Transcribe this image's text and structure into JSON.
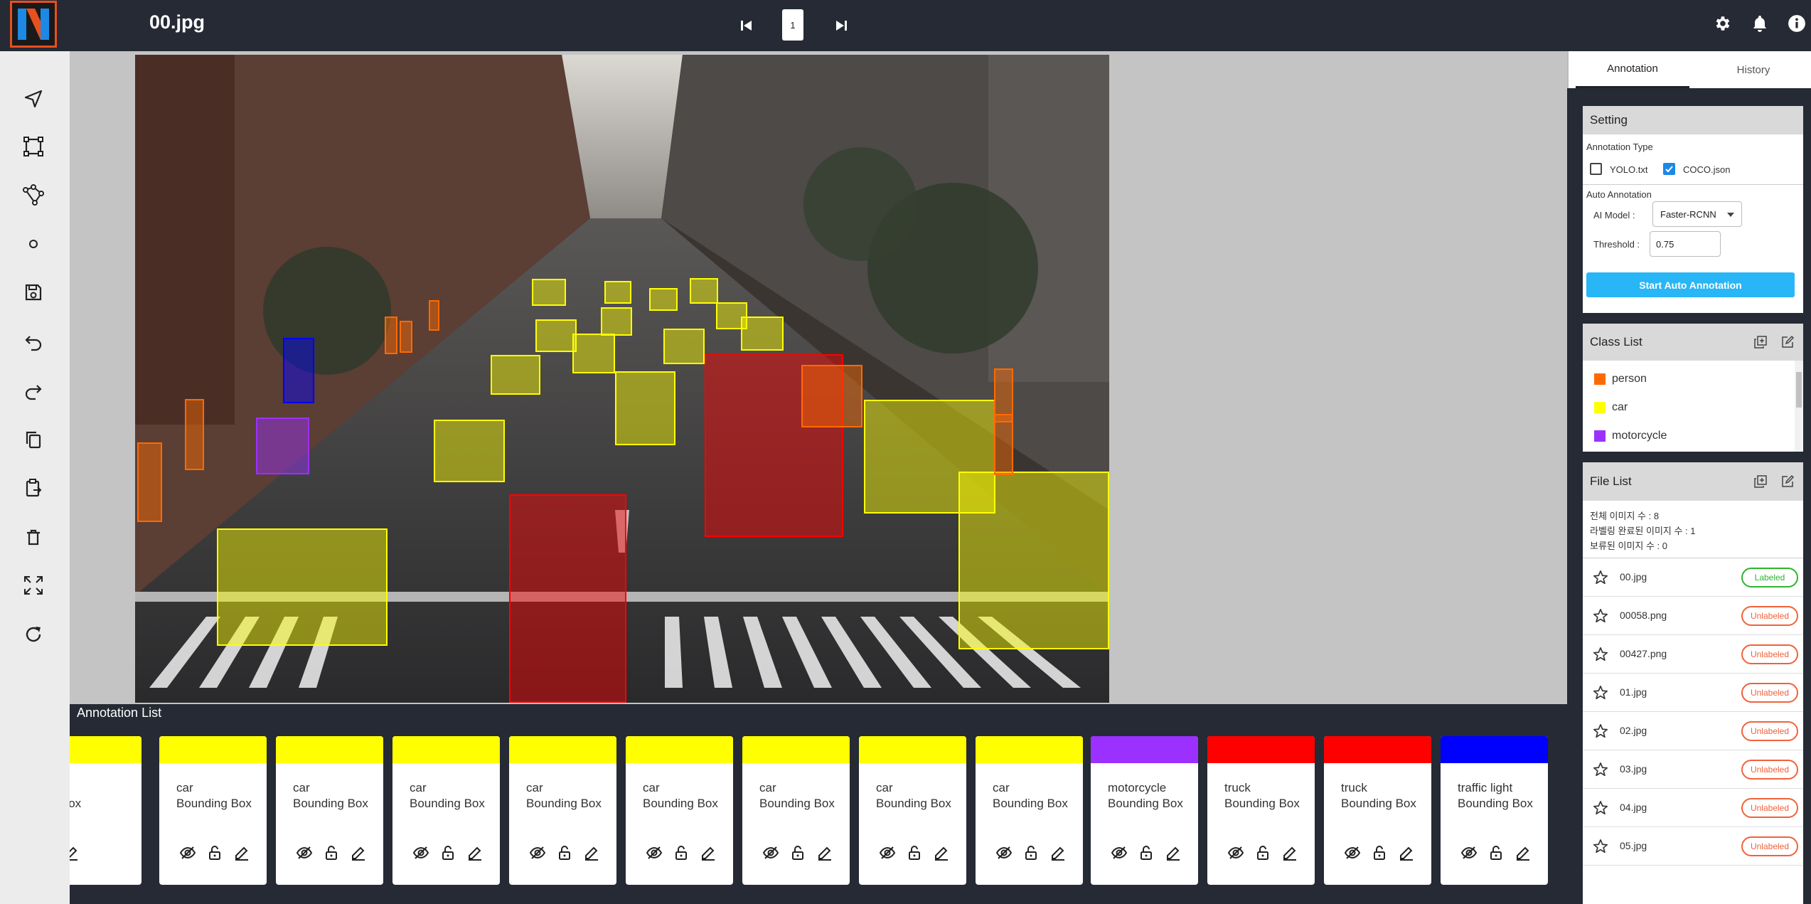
{
  "header": {
    "file_name": "00.jpg",
    "page_number": "1",
    "logo_letter": "N"
  },
  "colors": {
    "person": "#ff6a00",
    "car": "#ffff00",
    "motorcycle": "#9b30ff",
    "truck": "#ff0000",
    "traffic_light": "#0000ff",
    "labeled": "#2db52d",
    "unlabeled": "#f0623a",
    "accent": "#29b6f6"
  },
  "canvas": {
    "boxes": [
      {
        "cls": "car"
      },
      {
        "cls": "car"
      },
      {
        "cls": "car"
      },
      {
        "cls": "car"
      },
      {
        "cls": "car"
      },
      {
        "cls": "car"
      },
      {
        "cls": "car"
      },
      {
        "cls": "car"
      },
      {
        "cls": "car"
      },
      {
        "cls": "car"
      },
      {
        "cls": "car"
      },
      {
        "cls": "car"
      },
      {
        "cls": "car"
      },
      {
        "cls": "car"
      },
      {
        "cls": "car"
      },
      {
        "cls": "car"
      },
      {
        "cls": "truck"
      },
      {
        "cls": "truck"
      },
      {
        "cls": "person"
      },
      {
        "cls": "person"
      },
      {
        "cls": "person"
      },
      {
        "cls": "person"
      },
      {
        "cls": "person"
      },
      {
        "cls": "person"
      },
      {
        "cls": "person"
      },
      {
        "cls": "person"
      },
      {
        "cls": "motorcycle"
      },
      {
        "cls": "traffic_light"
      }
    ]
  },
  "annotation_list": {
    "title": "Annotation List",
    "cards": [
      {
        "cls": "car",
        "label": "",
        "type": "ding Box"
      },
      {
        "cls": "car",
        "label": "car",
        "type": "Bounding Box"
      },
      {
        "cls": "car",
        "label": "car",
        "type": "Bounding Box"
      },
      {
        "cls": "car",
        "label": "car",
        "type": "Bounding Box"
      },
      {
        "cls": "car",
        "label": "car",
        "type": "Bounding Box"
      },
      {
        "cls": "car",
        "label": "car",
        "type": "Bounding Box"
      },
      {
        "cls": "car",
        "label": "car",
        "type": "Bounding Box"
      },
      {
        "cls": "car",
        "label": "car",
        "type": "Bounding Box"
      },
      {
        "cls": "car",
        "label": "car",
        "type": "Bounding Box"
      },
      {
        "cls": "motorcycle",
        "label": "motorcycle",
        "type": "Bounding Box"
      },
      {
        "cls": "truck",
        "label": "truck",
        "type": "Bounding Box"
      },
      {
        "cls": "truck",
        "label": "truck",
        "type": "Bounding Box"
      },
      {
        "cls": "traffic_light",
        "label": "traffic light",
        "type": "Bounding Box"
      }
    ]
  },
  "tabs": {
    "annotation": "Annotation",
    "history": "History"
  },
  "setting": {
    "title": "Setting",
    "annotation_type_label": "Annotation Type",
    "yolo_label": "YOLO.txt",
    "yolo_checked": false,
    "coco_label": "COCO.json",
    "coco_checked": true,
    "auto_annotation_label": "Auto Annotation",
    "ai_model_label": "AI Model :",
    "ai_model_value": "Faster-RCNN",
    "threshold_label": "Threshold :",
    "threshold_value": "0.75",
    "start_button": "Start Auto Annotation"
  },
  "class_list": {
    "title": "Class List",
    "items": [
      {
        "name": "person",
        "color": "#ff6a00"
      },
      {
        "name": "car",
        "color": "#ffff00"
      },
      {
        "name": "motorcycle",
        "color": "#9b30ff"
      }
    ]
  },
  "file_list": {
    "title": "File List",
    "total": "전체 이미지 수 : 8",
    "labeled_count": "라벨링 완료된 이미지 수 : 1",
    "held_count": "보류된 이미지 수 : 0",
    "files": [
      {
        "name": "00.jpg",
        "status": "Labeled"
      },
      {
        "name": "00058.png",
        "status": "Unlabeled"
      },
      {
        "name": "00427.png",
        "status": "Unlabeled"
      },
      {
        "name": "01.jpg",
        "status": "Unlabeled"
      },
      {
        "name": "02.jpg",
        "status": "Unlabeled"
      },
      {
        "name": "03.jpg",
        "status": "Unlabeled"
      },
      {
        "name": "04.jpg",
        "status": "Unlabeled"
      },
      {
        "name": "05.jpg",
        "status": "Unlabeled"
      }
    ]
  }
}
